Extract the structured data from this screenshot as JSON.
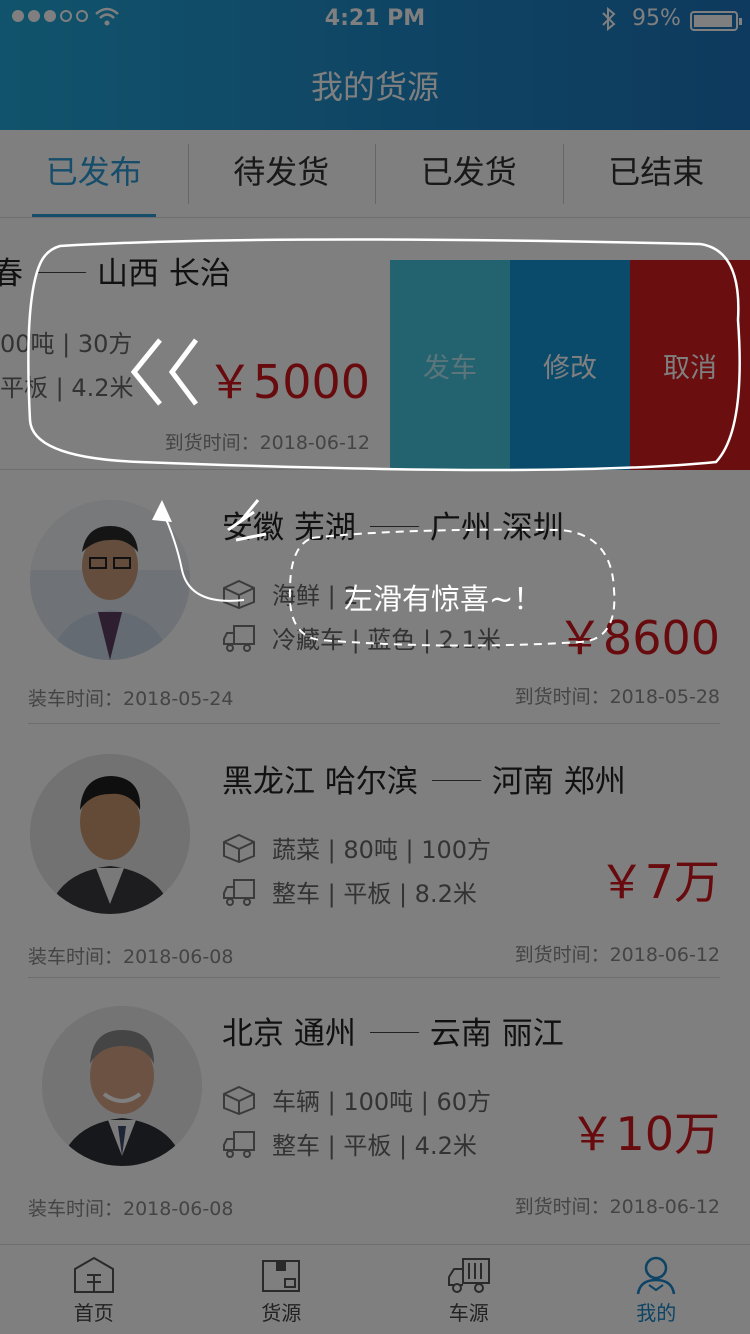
{
  "status": {
    "time": "4:21 PM",
    "battery": "95%"
  },
  "header": {
    "title": "我的货源"
  },
  "tabs": [
    {
      "label": "已发布",
      "active": true
    },
    {
      "label": "待发货"
    },
    {
      "label": "已发货"
    },
    {
      "label": "已结束"
    }
  ],
  "swiped_card": {
    "from_partial": "春",
    "to": "山西 长治",
    "cargo_partial": "00吨 | 30方",
    "truck_partial": "平板 | 4.2米",
    "price": "￥5000",
    "arrive": "到货时间：2018-06-12",
    "actions": {
      "depart": "发车",
      "edit": "修改",
      "cancel": "取消"
    }
  },
  "cards": [
    {
      "from": "安徽 芜湖",
      "to": "广州 深圳",
      "cargo": "海鲜 | 2",
      "truck": "冷藏车 | 蓝色 | 2.1米",
      "price": "￥8600",
      "load": "装车时间：2018-05-24",
      "arrive": "到货时间：2018-05-28"
    },
    {
      "from": "黑龙江 哈尔滨",
      "to": "河南 郑州",
      "cargo": "蔬菜 | 80吨 | 100方",
      "truck": "整车 | 平板 | 8.2米",
      "price": "￥7万",
      "load": "装车时间：2018-06-08",
      "arrive": "到货时间：2018-06-12"
    },
    {
      "from": "北京 通州",
      "to": "云南 丽江",
      "cargo": "车辆 | 100吨 | 60方",
      "truck": "整车 | 平板 | 4.2米",
      "price": "￥10万",
      "load": "装车时间：2018-06-08",
      "arrive": "到货时间：2018-06-12"
    }
  ],
  "guide": {
    "text": "左滑有惊喜~！"
  },
  "bottom_nav": [
    {
      "label": "首页",
      "icon": "home-icon"
    },
    {
      "label": "货源",
      "icon": "cargo-icon"
    },
    {
      "label": "车源",
      "icon": "truck-icon"
    },
    {
      "label": "我的",
      "icon": "user-icon",
      "active": true
    }
  ],
  "colors": {
    "accent": "#1a86c8",
    "price": "#d0161d",
    "cancel": "#d71c20",
    "edit": "#1496d6",
    "depart": "#46c6e0"
  }
}
